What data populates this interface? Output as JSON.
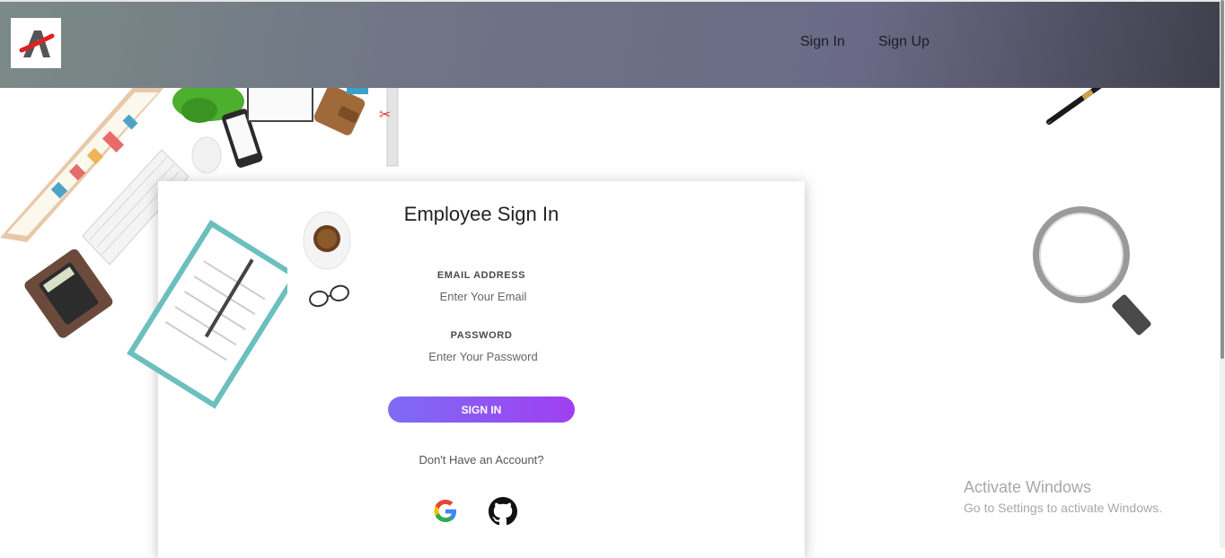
{
  "nav": {
    "logo_icon": "brand-logo-icon",
    "links": [
      {
        "label": "Sign In"
      },
      {
        "label": "Sign Up"
      }
    ]
  },
  "form": {
    "title": "Employee Sign In",
    "email": {
      "label": "EMAIL ADDRESS",
      "placeholder": "Enter Your Email",
      "value": ""
    },
    "password": {
      "label": "PASSWORD",
      "placeholder": "Enter Your Password",
      "value": ""
    },
    "submit_label": "SIGN IN",
    "no_account_text": "Don't Have an Account?",
    "social": [
      {
        "icon": "google-icon"
      },
      {
        "icon": "github-icon"
      }
    ]
  },
  "watermark": {
    "title": "Activate Windows",
    "subtitle": "Go to Settings to activate Windows."
  },
  "colors": {
    "button_gradient_start": "#7d6cf4",
    "button_gradient_end": "#a03ff0",
    "navbar_gradient": [
      "#7b8a86",
      "#6a6a86",
      "#3f3e4a"
    ]
  }
}
